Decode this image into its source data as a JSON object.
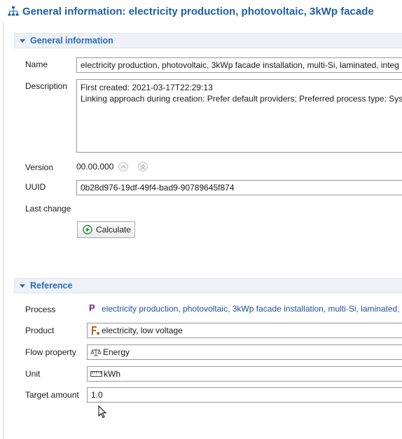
{
  "header": {
    "title": "General information: electricity production, photovoltaic, 3kWp facade"
  },
  "general": {
    "section_title": "General information",
    "name_label": "Name",
    "name_value": "electricity production, photovoltaic, 3kWp facade installation, multi-Si, laminated, integ",
    "description_label": "Description",
    "description_line1": "First created: 2021-03-17T22:29:13",
    "description_line2": "Linking approach during creation: Prefer default providers; Preferred process type: Syste",
    "version_label": "Version",
    "version_value": "00.00.000",
    "uuid_label": "UUID",
    "uuid_value": "0b28d976-19df-49f4-bad9-90789645f874",
    "last_change_label": "Last change",
    "calculate_label": "Calculate"
  },
  "reference": {
    "section_title": "Reference",
    "process_label": "Process",
    "process_value": "electricity production, photovoltaic, 3kWp facade installation, multi-Si, laminated,",
    "product_label": "Product",
    "product_value": "electricity, low voltage",
    "flow_property_label": "Flow property",
    "flow_property_value": "Energy",
    "unit_label": "Unit",
    "unit_value": "kWh",
    "target_amount_label": "Target amount",
    "target_amount_value": "1.0"
  },
  "colors": {
    "accent": "#1e5fa8",
    "section_bg": "#eef2f8",
    "process_icon": "#7a1f9c",
    "run_icon": "#2e8b3a",
    "product_icon": "#b5651d"
  }
}
